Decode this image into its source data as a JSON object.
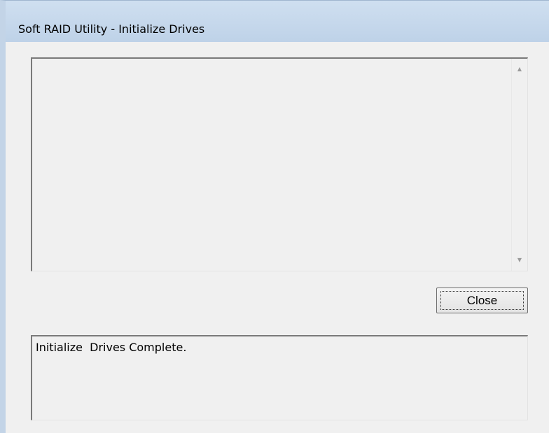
{
  "window": {
    "title": "Soft RAID Utility - Initialize Drives"
  },
  "log": {
    "text": "",
    "scroll_up_icon": "scroll-up-arrow",
    "scroll_down_icon": "scroll-down-arrow"
  },
  "buttons": {
    "close_label": "Close"
  },
  "status": {
    "message": "Initialize  Drives Complete."
  }
}
